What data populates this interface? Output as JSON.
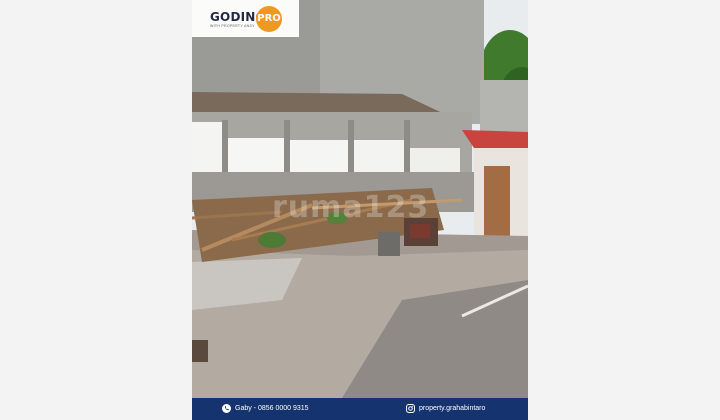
{
  "logo": {
    "brand": "GODING",
    "badge": "PRO",
    "tagline": "WITH PROPERTY ANSY"
  },
  "watermark": "ruma123",
  "footer": {
    "phone_text": "Gaby - 0856 0000 9315",
    "phone_icon": "phone-icon",
    "instagram_text": "property.grahabintaro",
    "instagram_icon": "instagram-icon",
    "background": "#15336e"
  },
  "accent": "#f29a1d"
}
